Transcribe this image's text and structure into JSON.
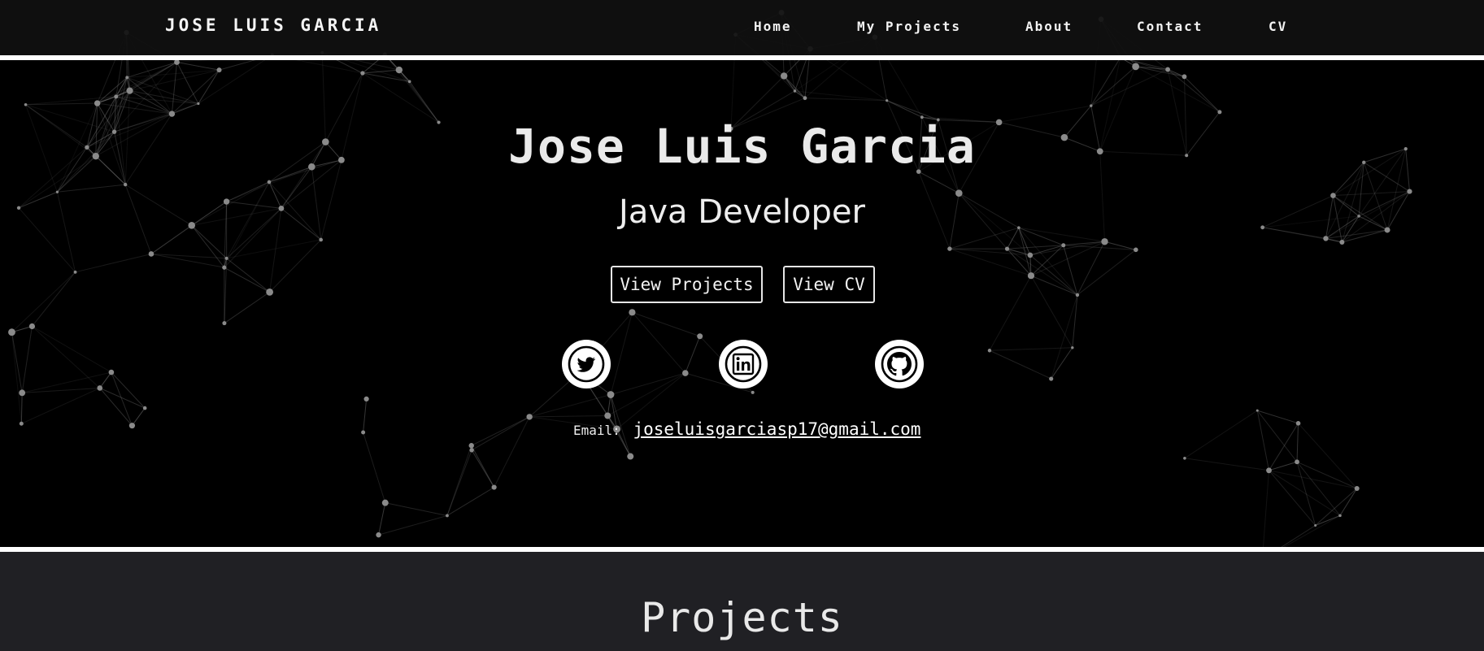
{
  "nav": {
    "brand": "JOSE LUIS GARCIA",
    "links": [
      "Home",
      "My Projects",
      "About",
      "Contact",
      "CV"
    ]
  },
  "hero": {
    "name": "Jose Luis Garcia",
    "role": "Java Developer",
    "buttons": {
      "projects": "View Projects",
      "cv": "View CV"
    },
    "socials": [
      {
        "icon": "twitter-icon"
      },
      {
        "icon": "linkedin-icon"
      },
      {
        "icon": "github-icon"
      }
    ],
    "email_label": "Email:",
    "email": "joseluisgarciasp17@gmail.com"
  },
  "projects": {
    "heading": "Projects"
  },
  "colors": {
    "background": "#000000",
    "navbar": "#101010",
    "rule": "#ffffff",
    "section": "#202024",
    "network": "#8a8a8a"
  }
}
